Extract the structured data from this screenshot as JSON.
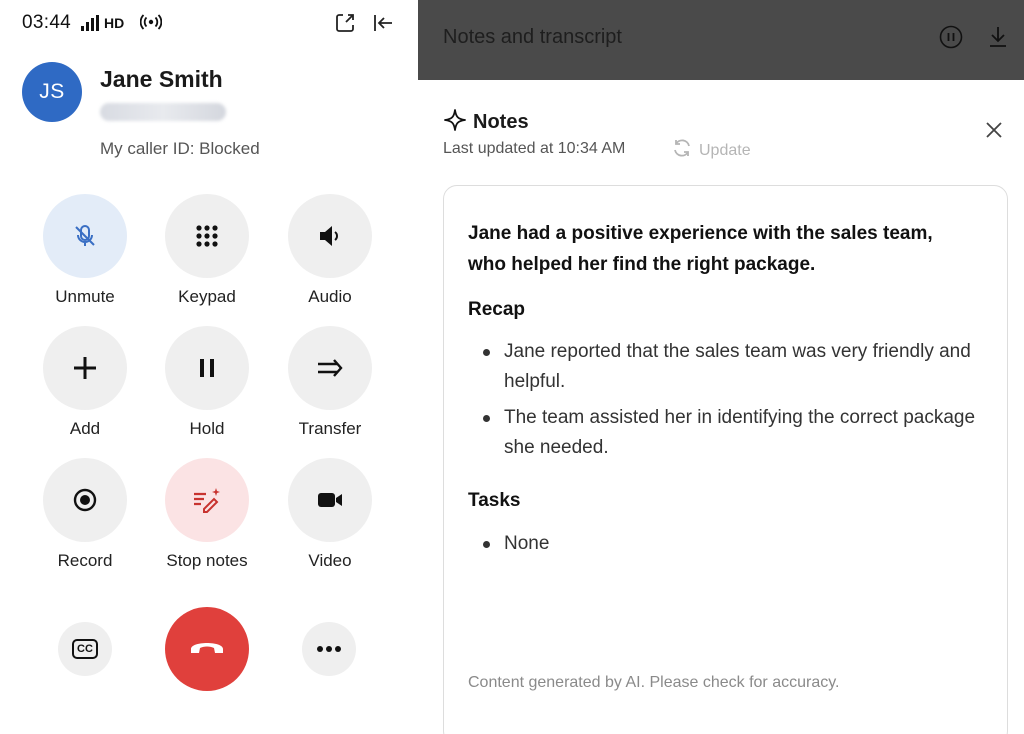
{
  "status_bar": {
    "time": "03:44",
    "network": "HD",
    "wifi_glyph": "(ı)"
  },
  "caller": {
    "initials": "JS",
    "name": "Jane Smith",
    "caller_id": "My caller ID: Blocked",
    "avatar_color": "#2f6ac4"
  },
  "controls": [
    {
      "label": "Unmute",
      "icon": "mic-off-icon"
    },
    {
      "label": "Keypad",
      "icon": "keypad-icon"
    },
    {
      "label": "Audio",
      "icon": "speaker-icon"
    },
    {
      "label": "Add",
      "icon": "plus-icon"
    },
    {
      "label": "Hold",
      "icon": "pause-icon"
    },
    {
      "label": "Transfer",
      "icon": "transfer-icon"
    },
    {
      "label": "Record",
      "icon": "record-icon"
    },
    {
      "label": "Stop notes",
      "icon": "ai-notes-icon"
    },
    {
      "label": "Video",
      "icon": "video-icon"
    }
  ],
  "bottom": {
    "captions_glyph": "CC",
    "end_call_color": "#e0403c",
    "more_icon": "more-dots-icon"
  },
  "notes_panel": {
    "header_title": "Notes and transcript",
    "notes_title": "Notes",
    "last_updated": "Last updated at 10:34 AM",
    "update_label": "Update",
    "summary": "Jane had a positive experience with the sales team, who helped her find the right package.",
    "recap_title": "Recap",
    "recap_items": [
      "Jane reported that the sales team was very friendly and helpful.",
      "The team assisted her in identifying the correct package she needed."
    ],
    "tasks_title": "Tasks",
    "tasks_items": [
      "None"
    ],
    "disclaimer": "Content generated by AI. Please check for accuracy.",
    "header_bg": "#4a4a4a"
  }
}
